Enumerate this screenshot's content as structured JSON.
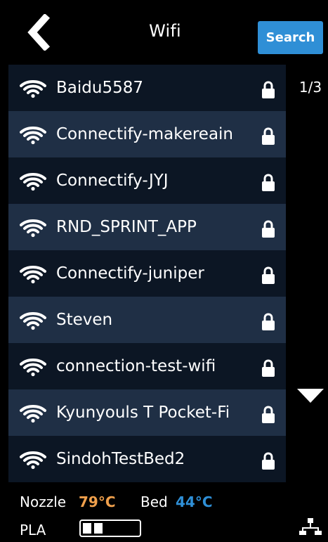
{
  "header": {
    "title": "Wifi",
    "search_label": "Search"
  },
  "list": {
    "networks": [
      {
        "ssid": "Baidu5587",
        "secured": true
      },
      {
        "ssid": "Connectify-makereain",
        "secured": true
      },
      {
        "ssid": "Connectify-JYJ",
        "secured": true
      },
      {
        "ssid": "RND_SPRINT_APP",
        "secured": true
      },
      {
        "ssid": "Connectify-juniper",
        "secured": true
      },
      {
        "ssid": "Steven",
        "secured": true
      },
      {
        "ssid": "connection-test-wifi",
        "secured": true
      },
      {
        "ssid": "Kyunyouls T Pocket-Fi",
        "secured": true
      },
      {
        "ssid": "SindohTestBed2",
        "secured": true
      }
    ]
  },
  "pager": {
    "page_indicator": "1/3"
  },
  "status": {
    "nozzle_label": "Nozzle",
    "nozzle_temp": "79°C",
    "bed_label": "Bed",
    "bed_temp": "44°C",
    "material_label": "PLA",
    "material_level_fraction": 0.25
  },
  "icons": {
    "back": "chevron-left-icon",
    "wifi": "wifi-icon",
    "lock": "lock-icon",
    "page_down": "triangle-down-icon",
    "network": "network-icon"
  },
  "colors": {
    "accent_blue": "#2f8fd6",
    "nozzle_temp": "#f0a04c",
    "bed_temp": "#2f8fd6",
    "row_dark": "#0c1624",
    "row_light": "#1f2f45",
    "background": "#000000"
  }
}
